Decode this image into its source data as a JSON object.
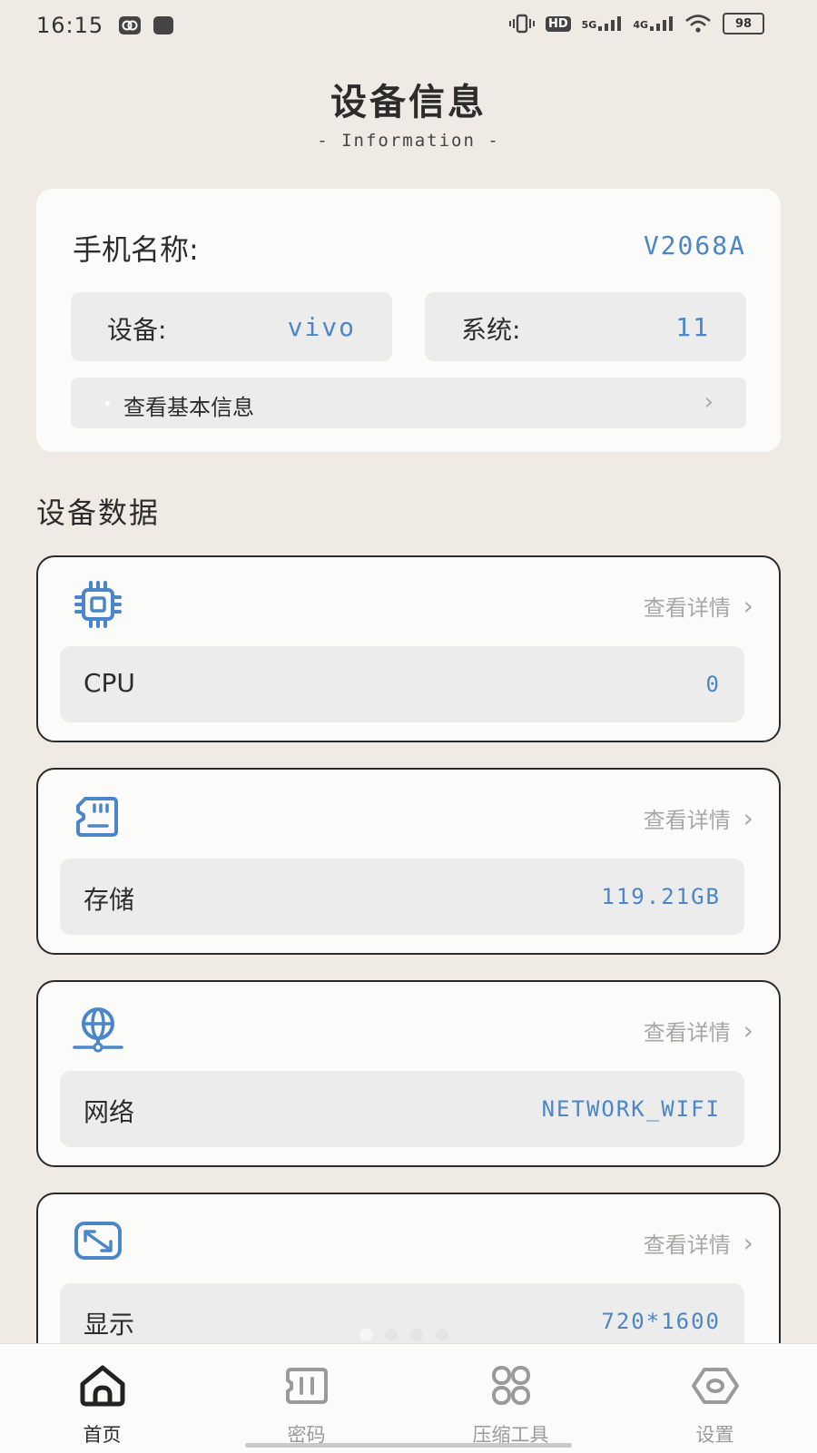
{
  "status_bar": {
    "time": "16:15",
    "hd": "HD",
    "net1": "5G",
    "net2": "4G",
    "battery": "98"
  },
  "header": {
    "title": "设备信息",
    "subtitle": "- Information -"
  },
  "info_card": {
    "phone_name_label": "手机名称:",
    "phone_name_value": "V2068A",
    "device_label": "设备:",
    "device_value": "vivo",
    "system_label": "系统:",
    "system_value": "11",
    "basic_info_label": "查看基本信息"
  },
  "section_title": "设备数据",
  "data_cards": [
    {
      "icon": "cpu-icon",
      "detail": "查看详情",
      "label": "CPU",
      "value": "0"
    },
    {
      "icon": "storage-icon",
      "detail": "查看详情",
      "label": "存储",
      "value": "119.21GB"
    },
    {
      "icon": "network-icon",
      "detail": "查看详情",
      "label": "网络",
      "value": "NETWORK_WIFI"
    },
    {
      "icon": "display-icon",
      "detail": "查看详情",
      "label": "显示",
      "value": "720*1600"
    }
  ],
  "bottom_nav": [
    {
      "label": "首页",
      "icon": "home-icon",
      "active": true
    },
    {
      "label": "密码",
      "icon": "password-icon",
      "active": false
    },
    {
      "label": "压缩工具",
      "icon": "grid-icon",
      "active": false
    },
    {
      "label": "设置",
      "icon": "settings-icon",
      "active": false
    }
  ],
  "colors": {
    "background": "#efebe4",
    "accent": "#4a86c8",
    "card": "#fbfbfa",
    "muted": "#a7a7a7"
  }
}
